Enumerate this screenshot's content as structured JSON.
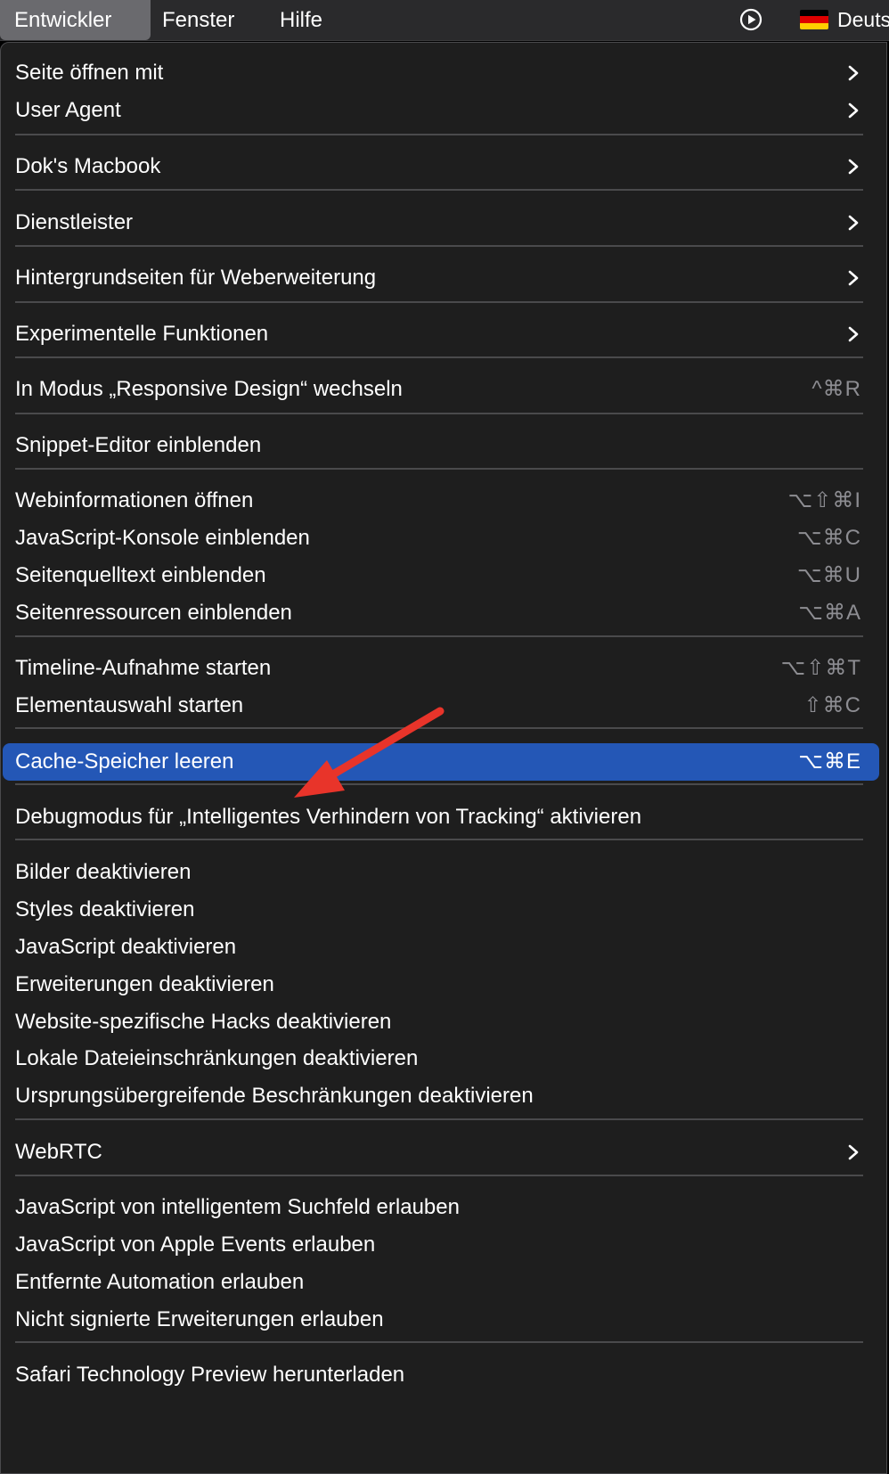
{
  "menubar": {
    "items": [
      "Entwickler",
      "Fenster",
      "Hilfe"
    ],
    "active_item": "Entwickler",
    "status_icons": [
      "play-circle-icon",
      "german-flag-icon"
    ],
    "language_label": "Deuts"
  },
  "menu": {
    "items": [
      {
        "label": "Seite öffnen mit",
        "submenu": true
      },
      {
        "label": "User Agent",
        "submenu": true
      },
      {
        "label": "Dok's Macbook",
        "submenu": true
      },
      {
        "label": "Dienstleister",
        "submenu": true
      },
      {
        "label": "Hintergrundseiten für Weberweiterung",
        "submenu": true
      },
      {
        "label": "Experimentelle Funktionen",
        "submenu": true
      },
      {
        "label": "In Modus „Responsive Design“ wechseln",
        "shortcut": "^⌘R"
      },
      {
        "label": "Snippet-Editor einblenden"
      },
      {
        "label": "Webinformationen öffnen",
        "shortcut": "⌥⇧⌘I"
      },
      {
        "label": "JavaScript-Konsole einblenden",
        "shortcut": "⌥⌘C"
      },
      {
        "label": "Seitenquelltext einblenden",
        "shortcut": "⌥⌘U"
      },
      {
        "label": "Seitenressourcen einblenden",
        "shortcut": "⌥⌘A"
      },
      {
        "label": "Timeline-Aufnahme starten",
        "shortcut": "⌥⇧⌘T"
      },
      {
        "label": "Elementauswahl starten",
        "shortcut": "⇧⌘C"
      },
      {
        "label": "Cache-Speicher leeren",
        "shortcut": "⌥⌘E",
        "highlighted": true
      },
      {
        "label": "Debugmodus für „Intelligentes Verhindern von Tracking“ aktivieren"
      },
      {
        "label": "Bilder deaktivieren"
      },
      {
        "label": "Styles deaktivieren"
      },
      {
        "label": "JavaScript deaktivieren"
      },
      {
        "label": "Erweiterungen deaktivieren"
      },
      {
        "label": "Website-spezifische Hacks deaktivieren"
      },
      {
        "label": "Lokale Dateieinschränkungen deaktivieren"
      },
      {
        "label": "Ursprungsübergreifende Beschränkungen deaktivieren"
      },
      {
        "label": "WebRTC",
        "submenu": true
      },
      {
        "label": "JavaScript von intelligentem Suchfeld erlauben"
      },
      {
        "label": "JavaScript von Apple Events erlauben"
      },
      {
        "label": "Entfernte Automation erlauben"
      },
      {
        "label": "Nicht signierte Erweiterungen erlauben"
      },
      {
        "label": "Safari Technology Preview herunterladen"
      }
    ]
  },
  "annotation": {
    "type": "red-arrow",
    "points_to": "Cache-Speicher leeren",
    "color": "#e8342a"
  },
  "colors": {
    "menu_background": "#1e1e1e",
    "highlight": "#2457b6",
    "shortcut_text": "#8d8d92",
    "separator": "#4a4a4c",
    "flag_black": "#000000",
    "flag_red": "#dd0000",
    "flag_gold": "#ffce00"
  }
}
